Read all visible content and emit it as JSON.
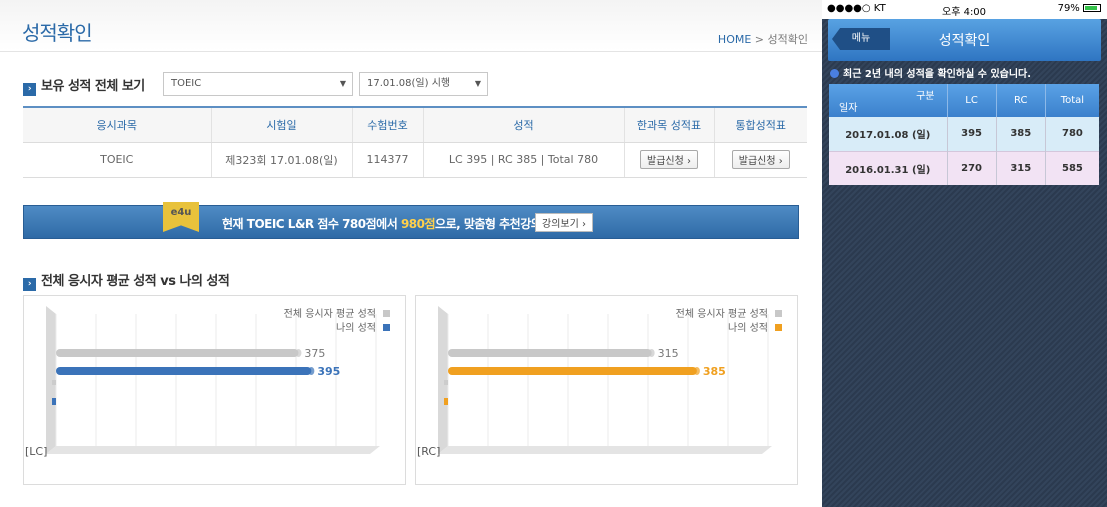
{
  "web": {
    "page_title": "성적확인",
    "breadcrumb": {
      "home": "HOME",
      "sep": ">",
      "current": "성적확인"
    },
    "section1_title": "보유 성적 전체 보기",
    "exam_select": "TOEIC",
    "date_select": "17.01.08(일) 시행",
    "table": {
      "headers": [
        "응시과목",
        "시험일",
        "수험번호",
        "성적",
        "한과목 성적표",
        "통합성적표"
      ],
      "row": {
        "subject": "TOEIC",
        "date": "제323회 17.01.08(일)",
        "number": "114377",
        "score": "LC 395 | RC 385 | Total 780",
        "btn1": "발급신청",
        "btn2": "발급신청"
      }
    },
    "banner": {
      "badge": "e4u",
      "msg_a": "현재 TOEIC L&R 점수 780점에서 ",
      "msg_hl": "980점",
      "msg_b": "으로, 맞춤형 추천강의",
      "button": "강의보기"
    },
    "section2_title": "전체 응시자 평균 성적 vs 나의 성적",
    "colors": {
      "accent": "#2b6aa8",
      "avg_bar": "#c8c8c8",
      "lc_bar": "#3b73b9",
      "rc_bar": "#f0a020"
    }
  },
  "chart_data": [
    {
      "type": "bar",
      "tag": "[LC]",
      "series": [
        {
          "name": "전체 응시자 평균 성적",
          "values": [
            375
          ],
          "label": "375"
        },
        {
          "name": "나의 성적",
          "values": [
            395
          ],
          "label": "395"
        }
      ],
      "xlim": [
        0,
        495
      ]
    },
    {
      "type": "bar",
      "tag": "[RC]",
      "series": [
        {
          "name": "전체 응시자 평균 성적",
          "values": [
            315
          ],
          "label": "315"
        },
        {
          "name": "나의 성적",
          "values": [
            385
          ],
          "label": "385"
        }
      ],
      "xlim": [
        0,
        495
      ]
    }
  ],
  "phone": {
    "carrier": "●●●●○ KT",
    "time": "오후 4:00",
    "battery": "79%",
    "menu_button": "메뉴",
    "title": "성적확인",
    "notice": "최근 2년 내의 성적을 확인하실 수 있습니다.",
    "table": {
      "corner_top": "구분",
      "corner_bottom": "일자",
      "headers": [
        "LC",
        "RC",
        "Total"
      ],
      "rows": [
        {
          "date": "2017.01.08 (일)",
          "lc": "395",
          "rc": "385",
          "total": "780"
        },
        {
          "date": "2016.01.31 (일)",
          "lc": "270",
          "rc": "315",
          "total": "585"
        }
      ]
    }
  }
}
